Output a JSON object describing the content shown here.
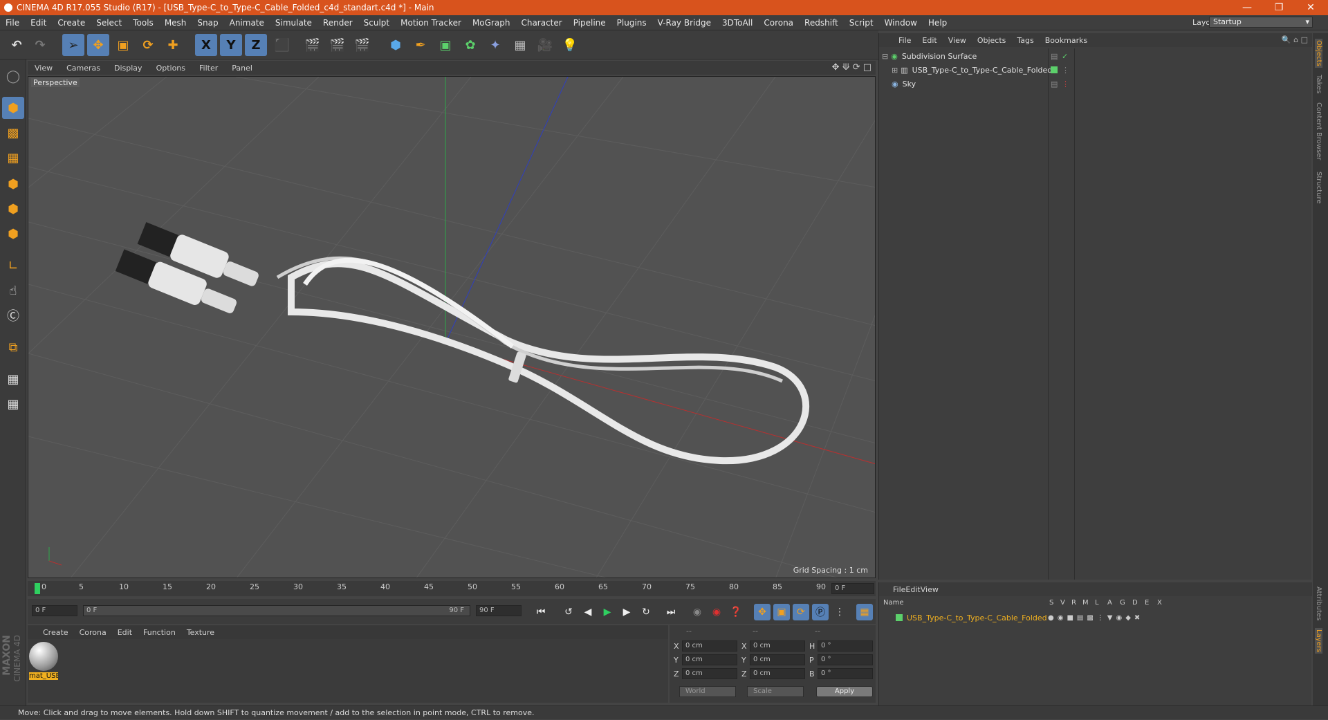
{
  "window": {
    "title": "CINEMA 4D R17.055 Studio (R17) - [USB_Type-C_to_Type-C_Cable_Folded_c4d_standart.c4d *] - Main"
  },
  "menubar": [
    "File",
    "Edit",
    "Create",
    "Select",
    "Tools",
    "Mesh",
    "Snap",
    "Animate",
    "Simulate",
    "Render",
    "Sculpt",
    "Motion Tracker",
    "MoGraph",
    "Character",
    "Pipeline",
    "Plugins",
    "V-Ray Bridge",
    "3DToAll",
    "Corona",
    "Redshift",
    "Script",
    "Window",
    "Help"
  ],
  "layout": {
    "label": "Layout:",
    "value": "Startup"
  },
  "toolbar_letters": {
    "x": "X",
    "y": "Y",
    "z": "Z"
  },
  "viewport": {
    "menu": [
      "View",
      "Cameras",
      "Display",
      "Options",
      "Filter",
      "Panel"
    ],
    "label": "Perspective",
    "grid_spacing": "Grid Spacing : 1 cm"
  },
  "timeline": {
    "ticks": [
      "0",
      "5",
      "10",
      "15",
      "20",
      "25",
      "30",
      "35",
      "40",
      "45",
      "50",
      "55",
      "60",
      "65",
      "70",
      "75",
      "80",
      "85",
      "90"
    ],
    "current_frame_field": "0 F",
    "start_field": "0 F",
    "range_start": "0 F",
    "range_end": "90 F",
    "end_field": "90 F"
  },
  "material_panel": {
    "menu": [
      "Create",
      "Corona",
      "Edit",
      "Function",
      "Texture"
    ],
    "material_name": "mat_USB"
  },
  "coords": {
    "headers": [
      "--",
      "--",
      "--"
    ],
    "rows": [
      {
        "a": "X",
        "av": "0 cm",
        "b": "X",
        "bv": "0 cm",
        "c": "H",
        "cv": "0 °"
      },
      {
        "a": "Y",
        "av": "0 cm",
        "b": "Y",
        "bv": "0 cm",
        "c": "P",
        "cv": "0 °"
      },
      {
        "a": "Z",
        "av": "0 cm",
        "b": "Z",
        "bv": "0 cm",
        "c": "B",
        "cv": "0 °"
      }
    ],
    "world": "World",
    "scale": "Scale",
    "apply": "Apply"
  },
  "objects_panel": {
    "menu": [
      "File",
      "Edit",
      "View",
      "Objects",
      "Tags",
      "Bookmarks"
    ],
    "items": [
      "Subdivision Surface",
      "USB_Type-C_to_Type-C_Cable_Folded",
      "Sky"
    ]
  },
  "layers_panel": {
    "menu": [
      "File",
      "Edit",
      "View"
    ],
    "name_header": "Name",
    "columns": [
      "S",
      "V",
      "R",
      "M",
      "L",
      "A",
      "G",
      "D",
      "E",
      "X"
    ],
    "row": "USB_Type-C_to_Type-C_Cable_Folded"
  },
  "right_tabs": [
    "Objects",
    "Takes",
    "Content Browser",
    "Structure",
    "Attributes",
    "Layers"
  ],
  "status": "Move: Click and drag to move elements. Hold down SHIFT to quantize movement / add to the selection in point mode, CTRL to remove.",
  "brand": {
    "line1": "MAXON",
    "line2": "CINEMA 4D"
  }
}
